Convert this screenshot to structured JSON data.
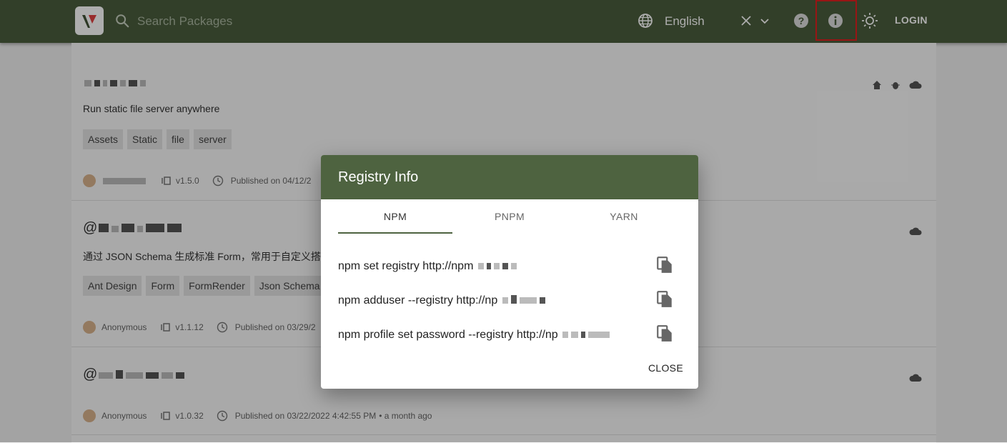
{
  "header": {
    "search_placeholder": "Search Packages",
    "language": "English",
    "login_label": "LOGIN"
  },
  "packages": [
    {
      "description": "Run static file server anywhere",
      "tags": [
        "Assets",
        "Static",
        "file",
        "server"
      ],
      "version": "v1.5.0",
      "published": "Published on 04/12/2"
    },
    {
      "name_prefix": "@",
      "description": "通过 JSON Schema 生成标准 Form，常用于自定义搭建",
      "tags": [
        "Ant Design",
        "Form",
        "FormRender",
        "Json Schema"
      ],
      "author": "Anonymous",
      "version": "v1.1.12",
      "published": "Published on 03/29/2"
    },
    {
      "name_prefix": "@",
      "author": "Anonymous",
      "version": "v1.0.32",
      "published": "Published on 03/22/2022 4:42:55 PM",
      "relative": "• a month ago"
    }
  ],
  "dialog": {
    "title": "Registry Info",
    "tabs": [
      "NPM",
      "PNPM",
      "YARN"
    ],
    "commands": [
      "npm set registry http://npm",
      "npm adduser --registry http://np",
      "npm profile set password --registry http://np"
    ],
    "close_label": "CLOSE"
  },
  "colors": {
    "header_bg": "#4b5e3d",
    "dialog_header_bg": "#4e6340",
    "highlight_border": "#e02020"
  }
}
